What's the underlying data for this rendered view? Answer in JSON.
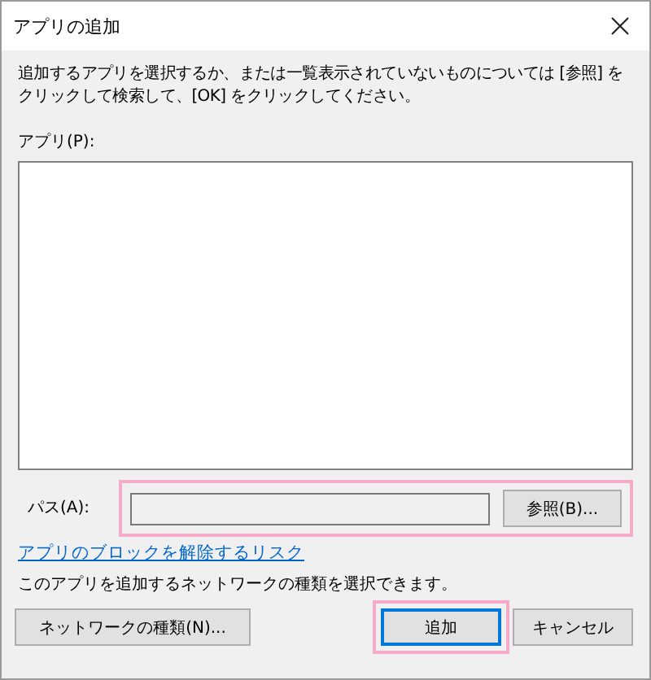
{
  "window": {
    "title": "アプリの追加"
  },
  "instruction": "追加するアプリを選択するか、または一覧表示されていないものについては [参照] をクリックして検索して、[OK] をクリックしてください。",
  "app_list": {
    "label": "アプリ(P):"
  },
  "path": {
    "label": "パス(A):",
    "browse_button": "参照(B)...",
    "highlighted": true
  },
  "link": "アプリのブロックを解除するリスク",
  "network_note": "このアプリを追加するネットワークの種類を選択できます。",
  "buttons": [
    {
      "label": "ネットワークの種類(N)...",
      "kind": "left",
      "default": false,
      "highlighted": false
    },
    {
      "label": "追加",
      "kind": "right",
      "default": true,
      "highlighted": true
    },
    {
      "label": "キャンセル",
      "kind": "right",
      "default": false,
      "highlighted": false
    }
  ]
}
